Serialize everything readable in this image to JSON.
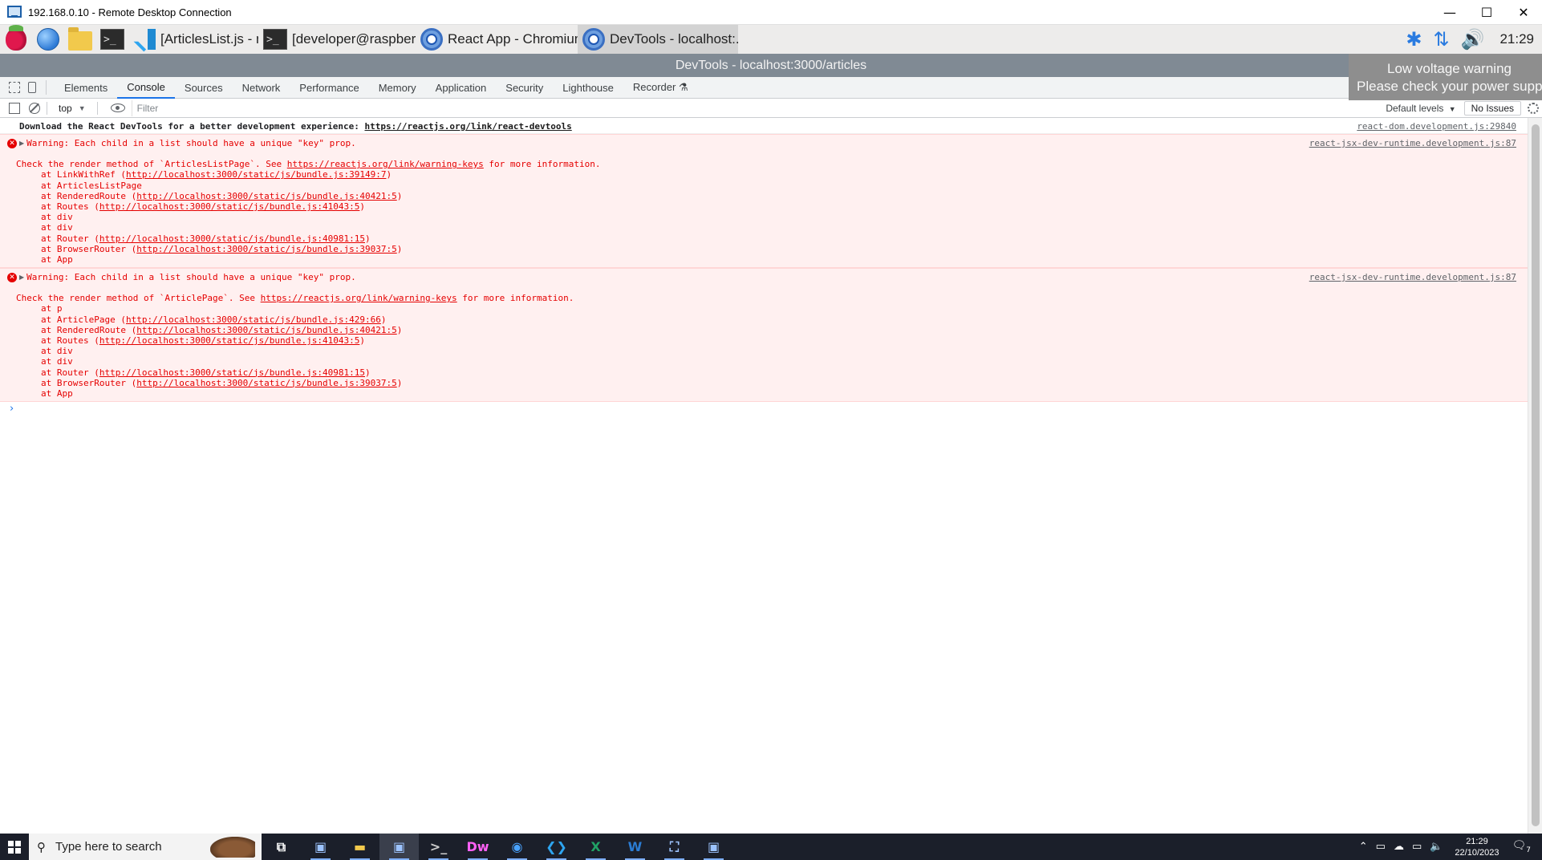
{
  "rdp": {
    "title": "192.168.0.10 - Remote Desktop Connection",
    "minimize": "—",
    "maximize": "☐",
    "close": "✕"
  },
  "pi_taskbar": {
    "term_glyph": ">_",
    "tasks": [
      {
        "label": "[ArticlesList.js - my_b...",
        "icon": "vscode-icon"
      },
      {
        "label": "[developer@raspberr...",
        "icon": "terminal-icon"
      },
      {
        "label": "React App - Chromium",
        "icon": "chromium-icon"
      },
      {
        "label": "DevTools - localhost:...",
        "icon": "chromium-icon",
        "active": true
      }
    ],
    "bluetooth": "✱",
    "network": "⇅",
    "volume": "🔊",
    "clock": "21:29"
  },
  "devtools": {
    "window_title": "DevTools - localhost:3000/articles",
    "tabs": [
      "Elements",
      "Console",
      "Sources",
      "Network",
      "Performance",
      "Memory",
      "Application",
      "Security",
      "Lighthouse",
      "Recorder ⚗"
    ],
    "active_tab": "Console",
    "toolbar": {
      "context": "top",
      "caret": "▼",
      "filter_placeholder": "Filter",
      "levels": "Default levels",
      "issues": "No Issues"
    }
  },
  "voltage_warning": {
    "line1": "Low voltage warning",
    "line2": "Please check your power suppl"
  },
  "console": {
    "info": {
      "text": "Download the React DevTools for a better development experience: ",
      "link": "https://reactjs.org/link/react-devtools",
      "source": "react-dom.development.js:29840"
    },
    "errors": [
      {
        "icon": "✕",
        "toggle": "▶",
        "headline": "Warning: Each child in a list should have a unique \"key\" prop.",
        "source": "react-jsx-dev-runtime.development.js:87",
        "check_pre": "Check the render method of `ArticlesListPage`. See ",
        "check_link": "https://reactjs.org/link/warning-keys",
        "check_post": " for more information.",
        "stack": [
          {
            "pre": "at LinkWithRef (",
            "link": "http://localhost:3000/static/js/bundle.js:39149:7",
            "post": ")"
          },
          {
            "pre": "at ArticlesListPage",
            "link": "",
            "post": ""
          },
          {
            "pre": "at RenderedRoute (",
            "link": "http://localhost:3000/static/js/bundle.js:40421:5",
            "post": ")"
          },
          {
            "pre": "at Routes (",
            "link": "http://localhost:3000/static/js/bundle.js:41043:5",
            "post": ")"
          },
          {
            "pre": "at div",
            "link": "",
            "post": ""
          },
          {
            "pre": "at div",
            "link": "",
            "post": ""
          },
          {
            "pre": "at Router (",
            "link": "http://localhost:3000/static/js/bundle.js:40981:15",
            "post": ")"
          },
          {
            "pre": "at BrowserRouter (",
            "link": "http://localhost:3000/static/js/bundle.js:39037:5",
            "post": ")"
          },
          {
            "pre": "at App",
            "link": "",
            "post": ""
          }
        ]
      },
      {
        "icon": "✕",
        "toggle": "▶",
        "headline": "Warning: Each child in a list should have a unique \"key\" prop.",
        "source": "react-jsx-dev-runtime.development.js:87",
        "check_pre": "Check the render method of `ArticlePage`. See ",
        "check_link": "https://reactjs.org/link/warning-keys",
        "check_post": " for more information.",
        "stack": [
          {
            "pre": "at p",
            "link": "",
            "post": ""
          },
          {
            "pre": "at ArticlePage (",
            "link": "http://localhost:3000/static/js/bundle.js:429:66",
            "post": ")"
          },
          {
            "pre": "at RenderedRoute (",
            "link": "http://localhost:3000/static/js/bundle.js:40421:5",
            "post": ")"
          },
          {
            "pre": "at Routes (",
            "link": "http://localhost:3000/static/js/bundle.js:41043:5",
            "post": ")"
          },
          {
            "pre": "at div",
            "link": "",
            "post": ""
          },
          {
            "pre": "at div",
            "link": "",
            "post": ""
          },
          {
            "pre": "at Router (",
            "link": "http://localhost:3000/static/js/bundle.js:40981:15",
            "post": ")"
          },
          {
            "pre": "at BrowserRouter (",
            "link": "http://localhost:3000/static/js/bundle.js:39037:5",
            "post": ")"
          },
          {
            "pre": "at App",
            "link": "",
            "post": ""
          }
        ]
      }
    ],
    "prompt": "›"
  },
  "windows_taskbar": {
    "search_placeholder": "Type here to search",
    "search_glyph": "⚲",
    "apps": [
      {
        "name": "task-view-icon",
        "glyph": "⧉",
        "color": "#ffffff"
      },
      {
        "name": "remote-desktop-app-icon",
        "glyph": "▣",
        "color": "#9cc3ff"
      },
      {
        "name": "file-explorer-icon",
        "glyph": "▬",
        "color": "#f2c94c"
      },
      {
        "name": "remote-desktop-active-icon",
        "glyph": "▣",
        "color": "#9cc3ff",
        "active": true
      },
      {
        "name": "terminal-app-icon",
        "glyph": ">_",
        "color": "#cccccc"
      },
      {
        "name": "dreamweaver-icon",
        "glyph": "Dw",
        "color": "#ff61f6"
      },
      {
        "name": "firefox-icon",
        "glyph": "◉",
        "color": "#4aa3ff"
      },
      {
        "name": "vscode-app-icon",
        "glyph": "❮❯",
        "color": "#2ea5f0"
      },
      {
        "name": "excel-icon",
        "glyph": "X",
        "color": "#21a366"
      },
      {
        "name": "word-icon",
        "glyph": "W",
        "color": "#2b7cd3"
      },
      {
        "name": "store-icon",
        "glyph": "⛶",
        "color": "#9cc3ff"
      },
      {
        "name": "rdp-app-icon",
        "glyph": "▣",
        "color": "#9cc3ff"
      }
    ],
    "tray_chevron": "⌃",
    "time": "21:29",
    "date": "22/10/2023",
    "notif_glyph": "🗨",
    "notif_count": "7"
  }
}
